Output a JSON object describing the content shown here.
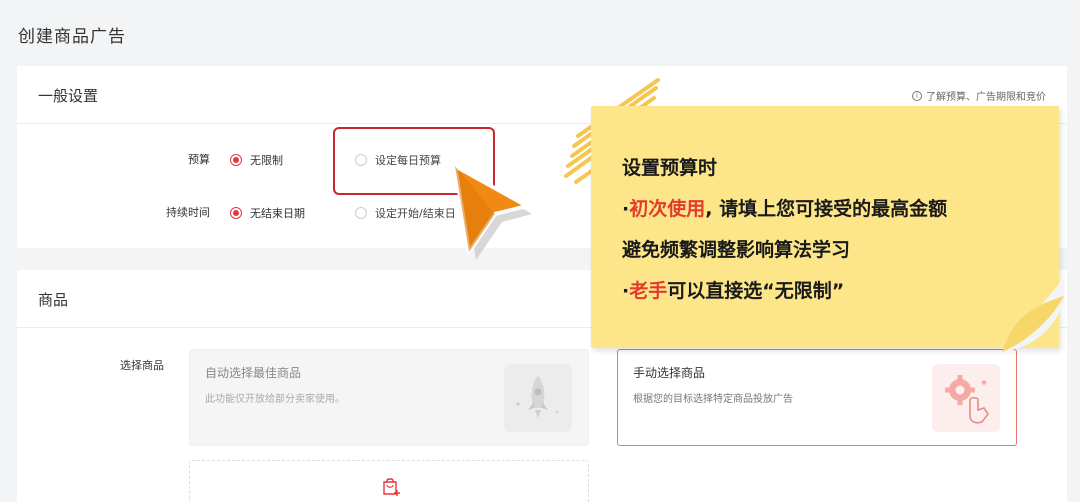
{
  "page": {
    "title": "创建商品广告"
  },
  "general": {
    "title": "一般设置",
    "help_text": "了解预算、广告期限和竞价",
    "budget": {
      "label": "预算",
      "opt_unlimited": "无限制",
      "opt_daily": "设定每日预算",
      "selected": "无限制"
    },
    "duration": {
      "label": "持续时间",
      "opt_no_end": "无结束日期",
      "opt_range": "设定开始/结束日",
      "selected": "无结束日期"
    }
  },
  "products": {
    "title": "商品",
    "right_label": "商品",
    "select_label": "选择商品",
    "auto": {
      "title": "自动选择最佳商品",
      "desc": "此功能仅开放给部分卖家使用。"
    },
    "manual": {
      "title": "手动选择商品",
      "desc": "根据您的目标选择特定商品投放广告"
    }
  },
  "note": {
    "line1": "设置预算时",
    "line2_prefix": "·",
    "line2_red": "初次使用",
    "line2_rest": ", 请填上您可接受的最高金额",
    "line3": "避免频繁调整影响算法学习",
    "line4_prefix": "·",
    "line4_red": "老手",
    "line4_rest": "可以直接选“无限制”"
  },
  "colors": {
    "accent": "#e4393c",
    "note_bg": "#fde68a",
    "pointer": "#f08a12",
    "highlight": "#c9252c"
  }
}
